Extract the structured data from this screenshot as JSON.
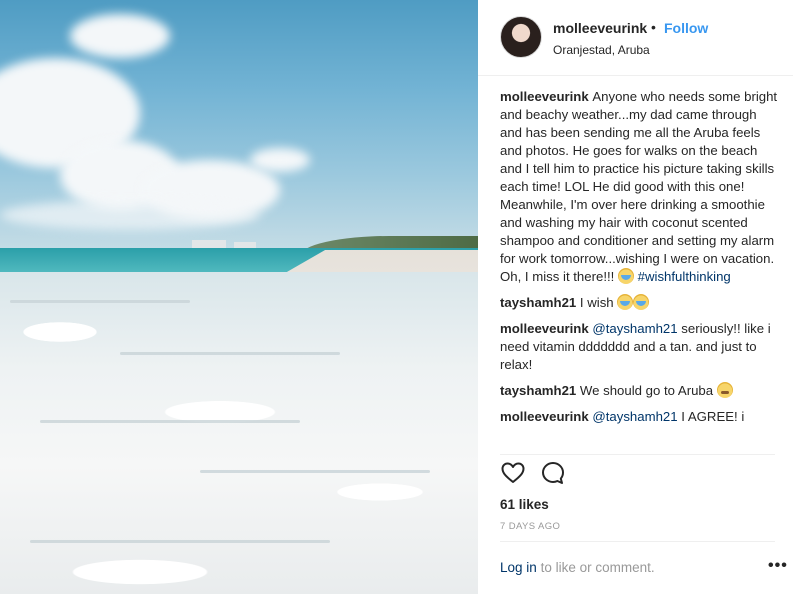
{
  "post": {
    "username": "molleeveurink",
    "separator": "•",
    "follow_label": "Follow",
    "location": "Oranjestad, Aruba"
  },
  "caption": {
    "username": "molleeveurink",
    "text": "Anyone who needs some bright and beachy weather...my dad came through and has been sending me all the Aruba feels and photos. He goes for walks on the beach and I tell him to practice his picture taking skills each time! LOL He did good with this one!\nMeanwhile, I'm over here drinking a smoothie and washing my hair with coconut scented shampoo and conditioner and setting my alarm for work tomorrow...wishing I were on vacation. Oh, I miss it there!!!",
    "hashtag": "#wishfulthinking"
  },
  "comments": [
    {
      "username": "tayshamh21",
      "text": "I wish"
    },
    {
      "username": "molleeveurink",
      "mention": "@tayshamh21",
      "text": "seriously!! like i need vitamin ddddddd and a tan. and just to relax!"
    },
    {
      "username": "tayshamh21",
      "text": "We should go to Aruba"
    },
    {
      "username": "molleeveurink",
      "mention": "@tayshamh21",
      "text": "I AGREE! i"
    }
  ],
  "actions": {
    "like_icon": "heart-outline-icon",
    "comment_icon": "speech-bubble-icon",
    "likes_label": "61 likes",
    "timestamp": "7 DAYS AGO"
  },
  "footer": {
    "login_link": "Log in",
    "login_suffix": "to like or comment.",
    "more_icon": "ellipsis-icon",
    "more_glyph": "•••"
  },
  "colors": {
    "link_blue": "#3897f0",
    "mention_navy": "#003569",
    "muted_gray": "#999999",
    "text_dark": "#262626"
  }
}
